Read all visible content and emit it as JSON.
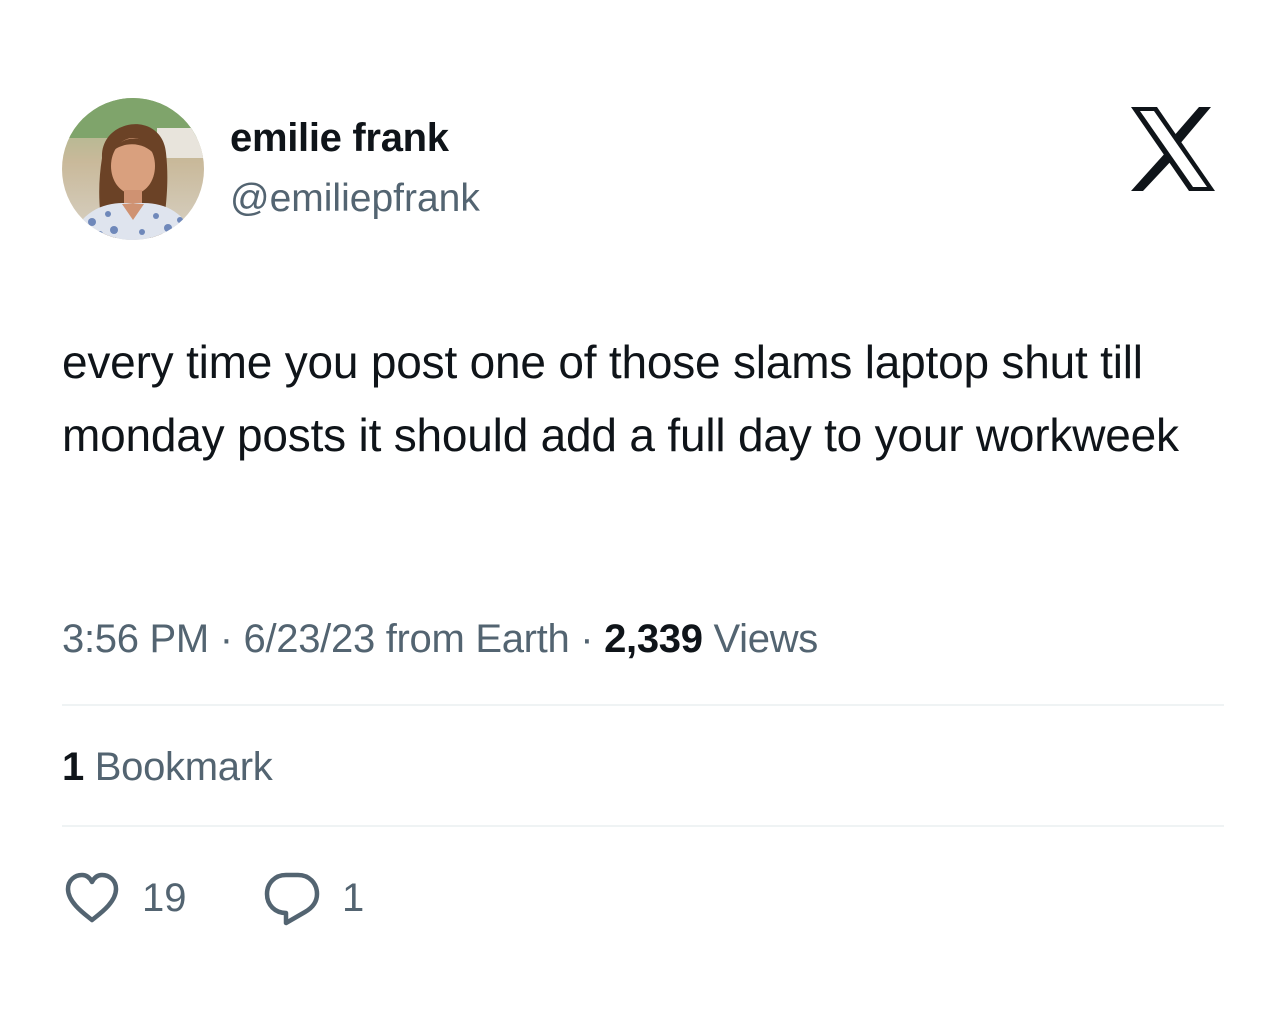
{
  "author": {
    "display_name": "emilie frank",
    "handle": "@emiliepfrank",
    "avatar_icon": "profile-photo"
  },
  "platform_icon": "x-logo-icon",
  "tweet": {
    "text": "every time you post one of those slams laptop shut till monday posts it should add a full day to your workweek"
  },
  "meta": {
    "time": "3:56 PM",
    "separator1": " · ",
    "date": "6/23/23",
    "source": " from Earth",
    "separator2": " · ",
    "views_count": "2,339",
    "views_label": " Views"
  },
  "bookmarks": {
    "count": "1",
    "label": " Bookmark"
  },
  "actions": {
    "likes": "19",
    "replies": "1"
  },
  "colors": {
    "text_primary": "#0f1419",
    "text_secondary": "#536471",
    "divider": "#eff3f4"
  }
}
